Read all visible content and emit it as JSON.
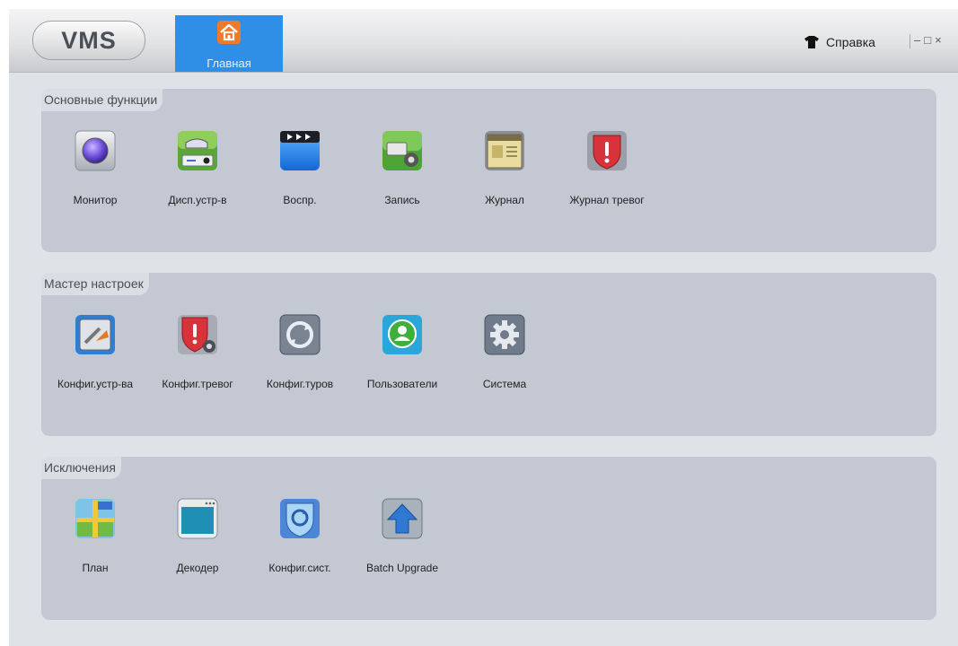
{
  "app": {
    "logo_text": "VMS"
  },
  "header": {
    "home_tab_label": "Главная",
    "help_label": "Справка",
    "window_controls": {
      "minimize": "–",
      "maximize": "□",
      "close": "×"
    }
  },
  "sections": [
    {
      "title": "Основные функции",
      "items": [
        {
          "label": "Монитор",
          "icon": "monitor-icon"
        },
        {
          "label": "Дисп.устр-в",
          "icon": "device-manager-icon"
        },
        {
          "label": "Воспр.",
          "icon": "playback-icon"
        },
        {
          "label": "Запись",
          "icon": "record-settings-icon"
        },
        {
          "label": "Журнал",
          "icon": "log-icon"
        },
        {
          "label": "Журнал тревог",
          "icon": "alarm-log-icon"
        }
      ]
    },
    {
      "title": "Мастер настроек",
      "items": [
        {
          "label": "Конфиг.устр-ва",
          "icon": "device-config-icon"
        },
        {
          "label": "Конфиг.тревог",
          "icon": "alarm-config-icon"
        },
        {
          "label": "Конфиг.туров",
          "icon": "tour-config-icon"
        },
        {
          "label": "Пользователи",
          "icon": "users-icon"
        },
        {
          "label": "Система",
          "icon": "system-gear-icon"
        }
      ]
    },
    {
      "title": "Исключения",
      "items": [
        {
          "label": "План",
          "icon": "map-plan-icon"
        },
        {
          "label": "Декодер",
          "icon": "decoder-icon"
        },
        {
          "label": "Конфиг.сист.",
          "icon": "system-config-icon"
        },
        {
          "label": "Batch Upgrade",
          "icon": "upgrade-arrow-icon"
        }
      ]
    }
  ]
}
